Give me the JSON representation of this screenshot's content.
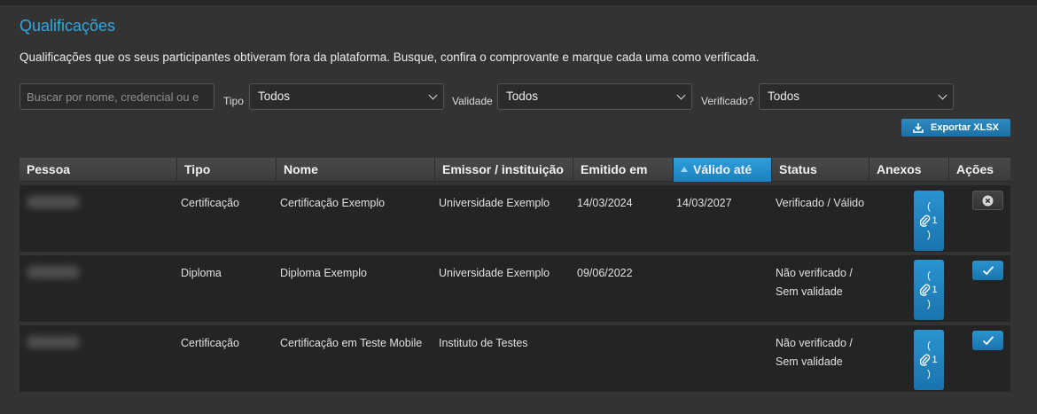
{
  "header": {
    "title": "Qualificações",
    "description": "Qualificações que os seus participantes obtiveram fora da plataforma. Busque, confira o comprovante e marque cada uma como verificada."
  },
  "filters": {
    "search_placeholder": "Buscar por nome, credencial ou e",
    "tipo_label": "Tipo",
    "tipo_value": "Todos",
    "validade_label": "Validade",
    "validade_value": "Todos",
    "verificado_label": "Verificado?",
    "verificado_value": "Todos"
  },
  "export": {
    "label": "Exportar XLSX",
    "icon": "download-icon"
  },
  "table": {
    "columns": [
      "Pessoa",
      "Tipo",
      "Nome",
      "Emissor / instituição",
      "Emitido em",
      "Válido até",
      "Status",
      "Anexos",
      "Ações"
    ],
    "sorted_column": "Válido até",
    "sort_direction": "ascending",
    "rows": [
      {
        "tipo": "Certificação",
        "nome": "Certificação Exemplo",
        "emissor": "Universidade Exemplo",
        "emitido": "14/03/2024",
        "valido": "14/03/2027",
        "status_line1": "Verificado / Válido",
        "status_line2": "",
        "attachments_open": "(",
        "attachments_count": "1",
        "attachments_close": ")",
        "action": "remove-verification"
      },
      {
        "tipo": "Diploma",
        "nome": "Diploma Exemplo",
        "emissor": "Universidade Exemplo",
        "emitido": "09/06/2022",
        "valido": "",
        "status_line1": "Não verificado /",
        "status_line2": "Sem validade",
        "attachments_open": "(",
        "attachments_count": "1",
        "attachments_close": ")",
        "action": "verify"
      },
      {
        "tipo": "Certificação",
        "nome": "Certificação em Teste Mobile",
        "emissor": "Instituto de Testes",
        "emitido": "",
        "valido": "",
        "status_line1": "Não verificado /",
        "status_line2": "Sem validade",
        "attachments_open": "(",
        "attachments_count": "1",
        "attachments_close": ")",
        "action": "verify"
      }
    ]
  },
  "colors": {
    "accent": "#2fa8e0",
    "button": "#1f7fbb",
    "background": "#333333",
    "row": "#242424"
  }
}
